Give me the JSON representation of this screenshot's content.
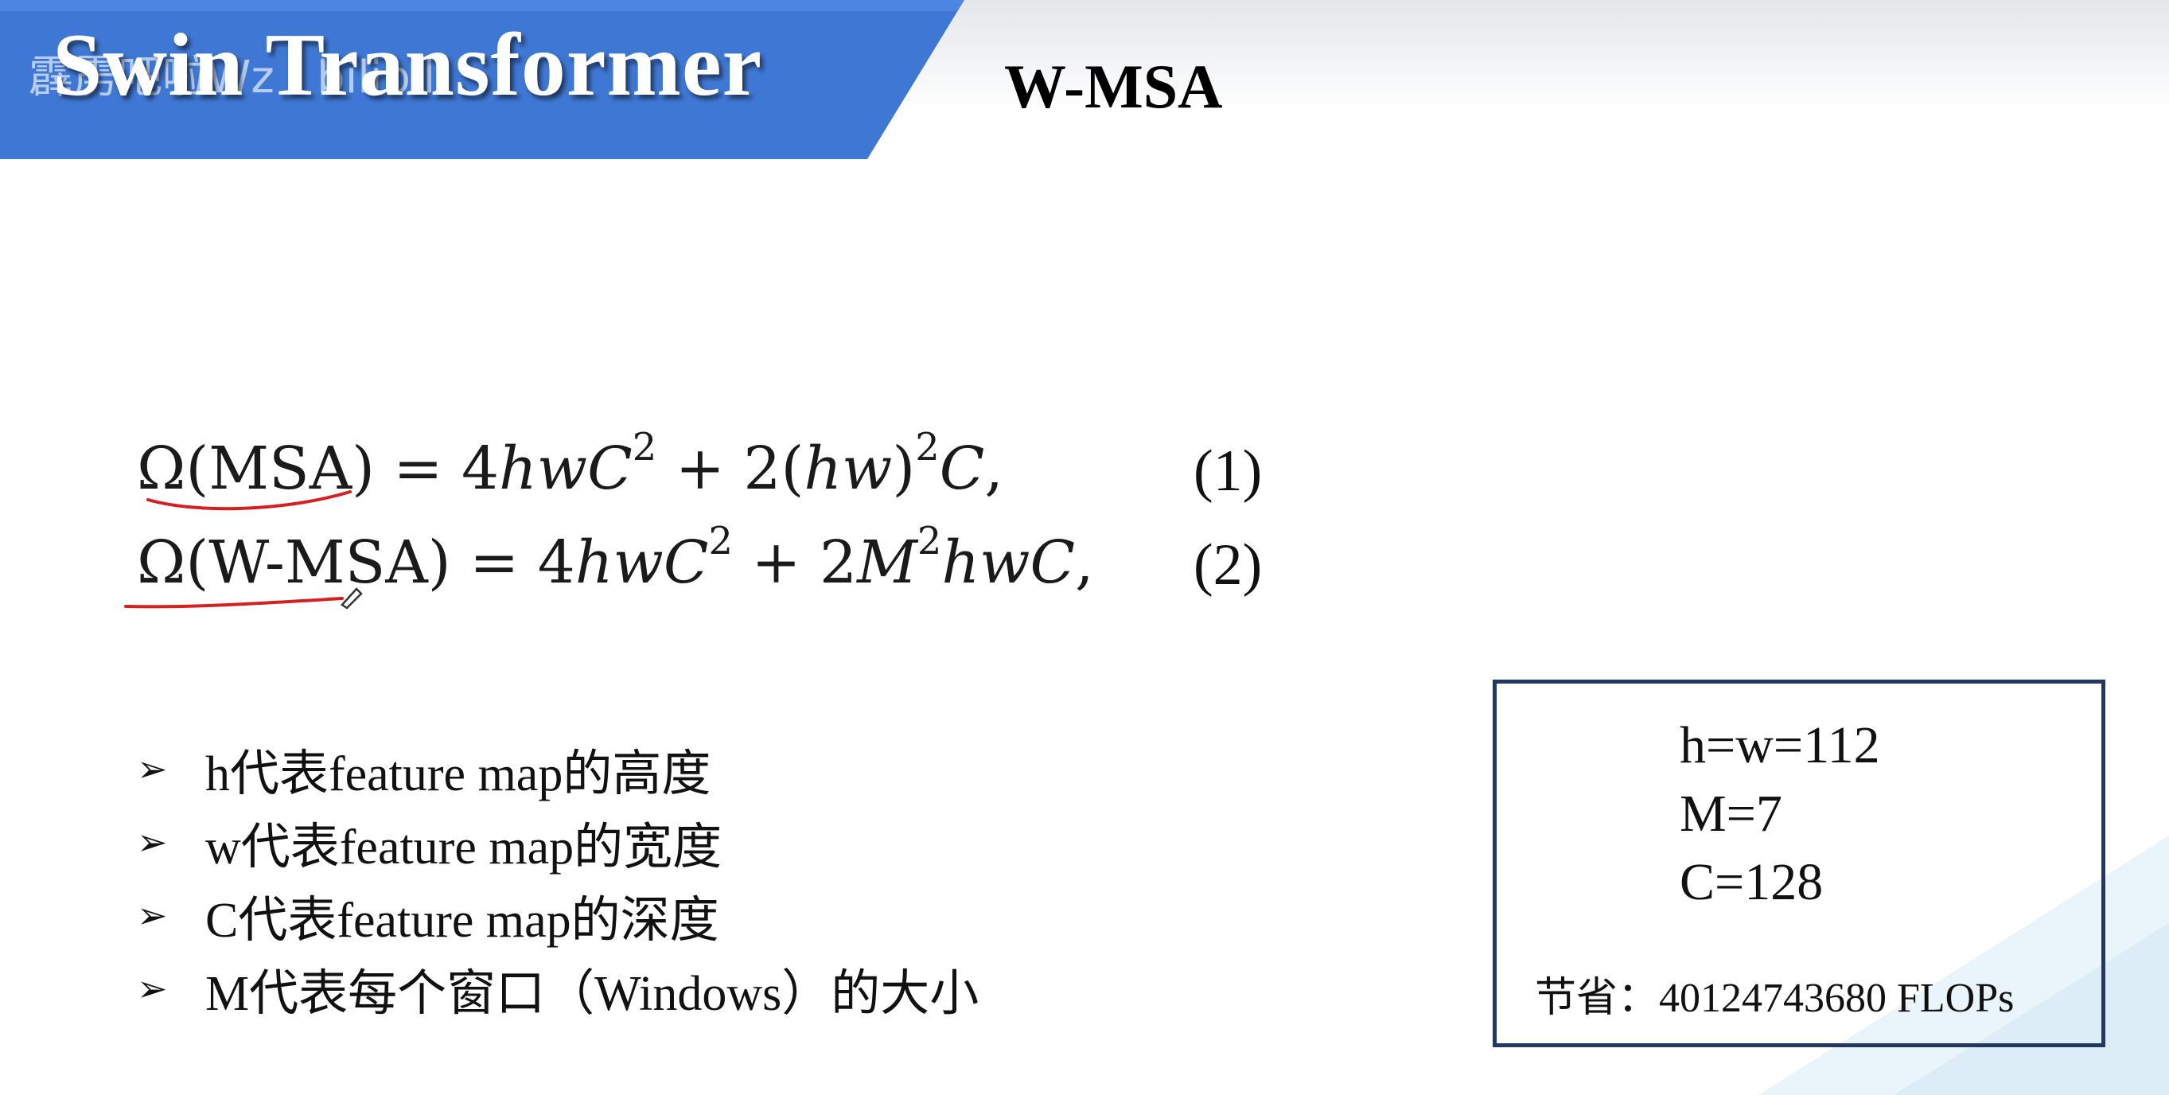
{
  "banner": {
    "title": "Swin Transformer",
    "watermark": "霹雳吧啦Wz · bilibili",
    "color": "#3f78d4"
  },
  "slide": {
    "title": "W-MSA"
  },
  "equations": [
    {
      "lhs": "Ω(MSA)",
      "rhs_prefix": " = 4",
      "rhs_a": "hwC",
      "rhs_a_exp": "2",
      "rhs_b_prefix": " + 2(",
      "rhs_b": "hw",
      "rhs_b_suffix": ")",
      "rhs_b_exp": "2",
      "rhs_c": "C",
      "tail": ",",
      "number": "(1)"
    },
    {
      "lhs": "Ω(W-MSA)",
      "rhs_prefix": " = 4",
      "rhs_a": "hwC",
      "rhs_a_exp": "2",
      "rhs_b_prefix": " + 2",
      "rhs_b": "M",
      "rhs_b_exp": "2",
      "rhs_c": "hwC",
      "tail": ",",
      "number": "(2)"
    }
  ],
  "annotation": {
    "underline_color": "#d42020"
  },
  "bullets": [
    "h代表feature map的高度",
    "w代表feature map的宽度",
    "C代表feature map的深度",
    "M代表每个窗口（Windows）的大小"
  ],
  "params": {
    "h_w": "h=w=112",
    "m": "M=7",
    "c": "C=128",
    "saving": "节省：40124743680 FLOPs",
    "border_color": "#22385e"
  }
}
